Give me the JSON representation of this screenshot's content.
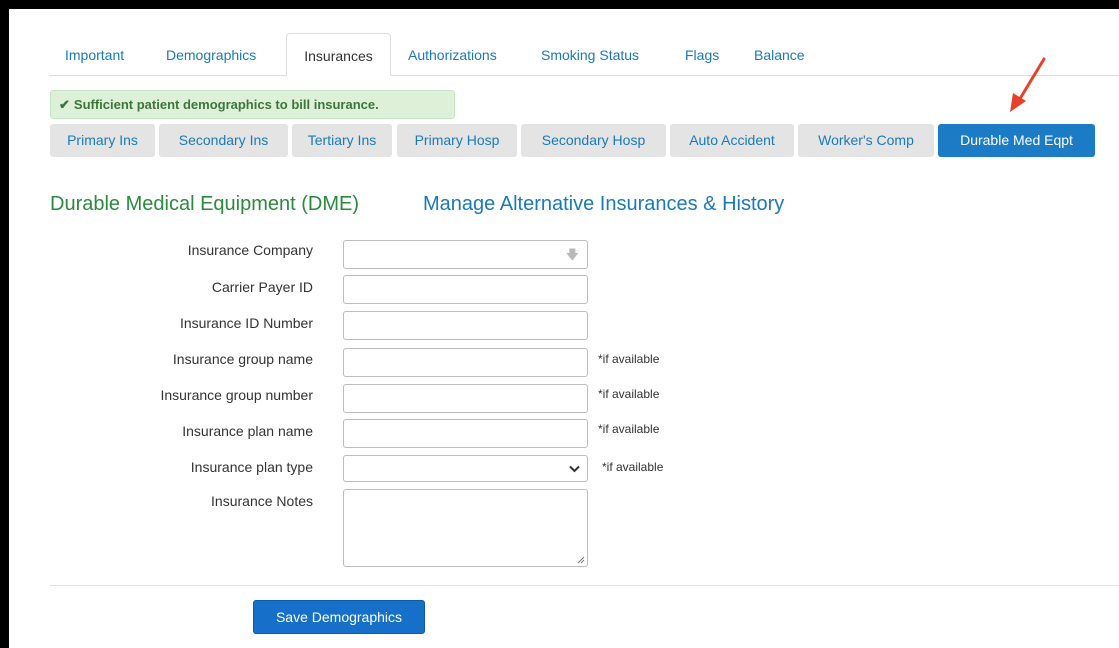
{
  "top_tabs": [
    "Important",
    "Demographics",
    "Insurances",
    "Authorizations",
    "Smoking Status",
    "Flags",
    "Balance"
  ],
  "active_top_tab": "Insurances",
  "alert": {
    "check_icon": "check-icon",
    "text": "Sufficient patient demographics to bill insurance."
  },
  "sub_tabs": [
    "Primary Ins",
    "Secondary Ins",
    "Tertiary Ins",
    "Primary Hosp",
    "Secondary Hosp",
    "Auto Accident",
    "Worker's Comp",
    "Durable Med Eqpt"
  ],
  "active_sub_tab": "Durable Med Eqpt",
  "section": {
    "title": "Durable Medical Equipment (DME)",
    "manage_link": "Manage Alternative Insurances & History"
  },
  "form": {
    "insurance_company": {
      "label": "Insurance Company",
      "value": ""
    },
    "carrier_payer_id": {
      "label": "Carrier Payer ID",
      "value": ""
    },
    "insurance_id_number": {
      "label": "Insurance ID Number",
      "value": ""
    },
    "group_name": {
      "label": "Insurance group name",
      "value": "",
      "hint": "*if available"
    },
    "group_number": {
      "label": "Insurance group number",
      "value": "",
      "hint": "*if available"
    },
    "plan_name": {
      "label": "Insurance plan name",
      "value": "",
      "hint": "*if available"
    },
    "plan_type": {
      "label": "Insurance plan type",
      "value": "",
      "hint": "*if available"
    },
    "notes": {
      "label": "Insurance Notes",
      "value": ""
    }
  },
  "save_button": "Save Demographics",
  "colors": {
    "link": "#1a7ab9",
    "active_tab": "#1b7bc4",
    "success_bg": "#dff0d8",
    "heading_green": "#2b8a3e",
    "annotation_arrow": "#e8402a"
  }
}
